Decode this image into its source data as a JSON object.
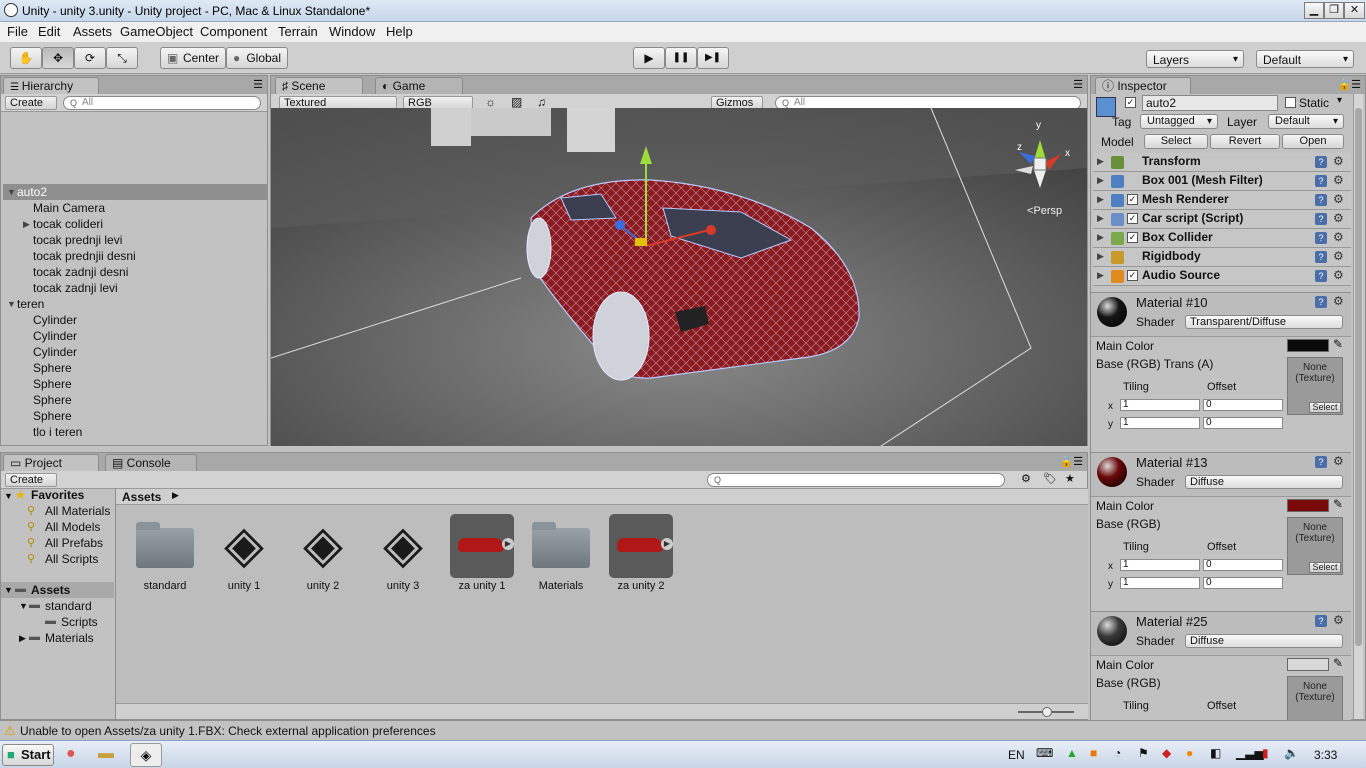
{
  "window": {
    "title": "Unity - unity 3.unity - Unity project - PC, Mac & Linux Standalone*",
    "min": "▁",
    "max": "❐",
    "close": "✕"
  },
  "menu": [
    "File",
    "Edit",
    "Assets",
    "GameObject",
    "Component",
    "Terrain",
    "Window",
    "Help"
  ],
  "toolbar": {
    "pivot": "Center",
    "space": "Global",
    "play": "▶",
    "pause": "❚❚",
    "step": "▶❚",
    "layers": "Layers",
    "layout": "Default"
  },
  "hierarchy": {
    "tab": "Hierarchy",
    "create": "Create",
    "search_placeholder": "All",
    "items": [
      {
        "label": "auto2",
        "indent": 0,
        "arrow": "▼",
        "selected": true
      },
      {
        "label": "Main Camera",
        "indent": 1,
        "arrow": ""
      },
      {
        "label": "tocak colideri",
        "indent": 1,
        "arrow": "▶"
      },
      {
        "label": "tocak prednji levi",
        "indent": 1,
        "arrow": ""
      },
      {
        "label": "tocak prednjii desni",
        "indent": 1,
        "arrow": ""
      },
      {
        "label": "tocak zadnji desni",
        "indent": 1,
        "arrow": ""
      },
      {
        "label": "tocak zadnji levi",
        "indent": 1,
        "arrow": ""
      },
      {
        "label": "teren",
        "indent": 0,
        "arrow": "▼"
      },
      {
        "label": "Cylinder",
        "indent": 1,
        "arrow": ""
      },
      {
        "label": "Cylinder",
        "indent": 1,
        "arrow": ""
      },
      {
        "label": "Cylinder",
        "indent": 1,
        "arrow": ""
      },
      {
        "label": "Sphere",
        "indent": 1,
        "arrow": ""
      },
      {
        "label": "Sphere",
        "indent": 1,
        "arrow": ""
      },
      {
        "label": "Sphere",
        "indent": 1,
        "arrow": ""
      },
      {
        "label": "Sphere",
        "indent": 1,
        "arrow": ""
      },
      {
        "label": "tlo i teren",
        "indent": 1,
        "arrow": ""
      }
    ]
  },
  "scene": {
    "tab_scene": "Scene",
    "tab_game": "Game",
    "render_mode": "Textured",
    "color_mode": "RGB",
    "gizmos": "Gizmos",
    "search_placeholder": "All",
    "persp": "Persp",
    "axis_x": "x",
    "axis_y": "y",
    "axis_z": "z"
  },
  "inspector": {
    "tab": "Inspector",
    "object_name": "auto2",
    "static_label": "Static",
    "tag_label": "Tag",
    "tag_value": "Untagged",
    "layer_label": "Layer",
    "layer_value": "Default",
    "model_label": "Model",
    "select": "Select",
    "revert": "Revert",
    "open": "Open",
    "components": [
      {
        "label": "Transform",
        "check": false,
        "color": "#6a8f3a"
      },
      {
        "label": "Box 001 (Mesh Filter)",
        "check": false,
        "color": "#4f7fc0"
      },
      {
        "label": "Mesh Renderer",
        "check": true,
        "color": "#4f7fc0"
      },
      {
        "label": "Car script (Script)",
        "check": true,
        "color": "#6a8fc8"
      },
      {
        "label": "Box Collider",
        "check": true,
        "color": "#7ba84a"
      },
      {
        "label": "Rigidbody",
        "check": false,
        "color": "#c89a2a"
      },
      {
        "label": "Audio Source",
        "check": true,
        "color": "#e08a20"
      }
    ],
    "materials": [
      {
        "name": "Material #10",
        "shader": "Transparent/Diffuse",
        "color_label": "Main Color",
        "base_label": "Base (RGB) Trans (A)",
        "swatch": "#0a0a0a",
        "ball": "#151515",
        "tiling_x": "1",
        "tiling_y": "1",
        "offset_x": "0",
        "offset_y": "0"
      },
      {
        "name": "Material #13",
        "shader": "Diffuse",
        "color_label": "Main Color",
        "base_label": "Base (RGB)",
        "swatch": "#7a0a0a",
        "ball": "#6a0808",
        "tiling_x": "1",
        "tiling_y": "1",
        "offset_x": "0",
        "offset_y": "0"
      },
      {
        "name": "Material #25",
        "shader": "Diffuse",
        "color_label": "Main Color",
        "base_label": "Base (RGB)",
        "swatch": "#d8d8d8",
        "ball": "#3a3a3a"
      }
    ],
    "shader_label": "Shader",
    "tiling": "Tiling",
    "offset": "Offset",
    "x": "x",
    "y": "y",
    "tex_none": "None",
    "tex_texture": "(Texture)",
    "tex_select": "Select"
  },
  "project": {
    "tab_project": "Project",
    "tab_console": "Console",
    "create": "Create",
    "favorites": "Favorites",
    "fav_items": [
      "All Materials",
      "All Models",
      "All Prefabs",
      "All Scripts"
    ],
    "assets_root": "Assets",
    "tree": [
      {
        "label": "standard",
        "arrow": "▼",
        "indent": 1
      },
      {
        "label": "Scripts",
        "arrow": "",
        "indent": 2
      },
      {
        "label": "Materials",
        "arrow": "▶",
        "indent": 1
      }
    ],
    "breadcrumb": "Assets",
    "assets": [
      {
        "label": "standard",
        "kind": "folder"
      },
      {
        "label": "unity 1",
        "kind": "unity"
      },
      {
        "label": "unity 2",
        "kind": "unity"
      },
      {
        "label": "unity 3",
        "kind": "unity"
      },
      {
        "label": "za unity 1",
        "kind": "car"
      },
      {
        "label": "Materials",
        "kind": "folder"
      },
      {
        "label": "za unity 2",
        "kind": "car"
      }
    ]
  },
  "status": {
    "message": "Unable to open Assets/za unity 1.FBX: Check external application preferences"
  },
  "taskbar": {
    "start": "Start",
    "lang": "EN",
    "time": "3:33"
  }
}
